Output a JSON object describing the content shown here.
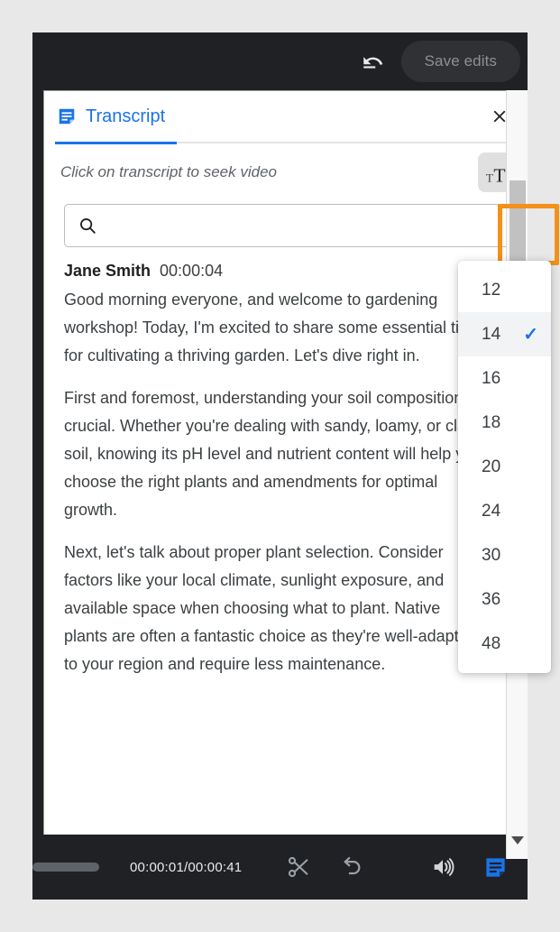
{
  "top_bar": {
    "undo_icon": "undo-icon",
    "save_label": "Save edits"
  },
  "panel": {
    "tab_icon": "transcript-icon",
    "tab_label": "Transcript",
    "close_icon": "close-icon",
    "seek_hint": "Click on transcript to seek video",
    "font_size_icon": "font-size-icon",
    "search": {
      "icon": "search-icon",
      "value": "",
      "placeholder": ""
    }
  },
  "font_size_menu": {
    "selected": "14",
    "check_glyph": "✓",
    "options": [
      {
        "label": "12",
        "selected": false
      },
      {
        "label": "14",
        "selected": true
      },
      {
        "label": "16",
        "selected": false
      },
      {
        "label": "18",
        "selected": false
      },
      {
        "label": "20",
        "selected": false
      },
      {
        "label": "24",
        "selected": false
      },
      {
        "label": "30",
        "selected": false
      },
      {
        "label": "36",
        "selected": false
      },
      {
        "label": "48",
        "selected": false
      }
    ]
  },
  "transcript": {
    "speaker": "Jane Smith",
    "timestamp": "00:00:04",
    "paragraphs": [
      "Good morning everyone, and welcome to gardening workshop! Today, I'm excited to share some essential tips for cultivating a thriving garden. Let's dive right in.",
      "First and foremost, understanding your soil composition is crucial. Whether you're dealing with sandy, loamy, or clay soil, knowing its pH level and nutrient content will help you choose the right plants and amendments for optimal growth.",
      "Next, let's talk about proper plant selection. Consider factors like your local climate, sunlight exposure, and available space when choosing what to plant. Native plants are often a fantastic choice as they're well-adapted to your region and require less maintenance."
    ]
  },
  "bottom_bar": {
    "time": "00:00:01/00:00:41",
    "trim_icon": "scissors-icon",
    "undo_icon": "undo-icon",
    "volume_icon": "volume-icon",
    "transcript_icon": "transcript-icon"
  },
  "colors": {
    "accent_blue": "#1a73e8",
    "highlight_orange": "#f59018",
    "dark_chrome": "#202124"
  }
}
